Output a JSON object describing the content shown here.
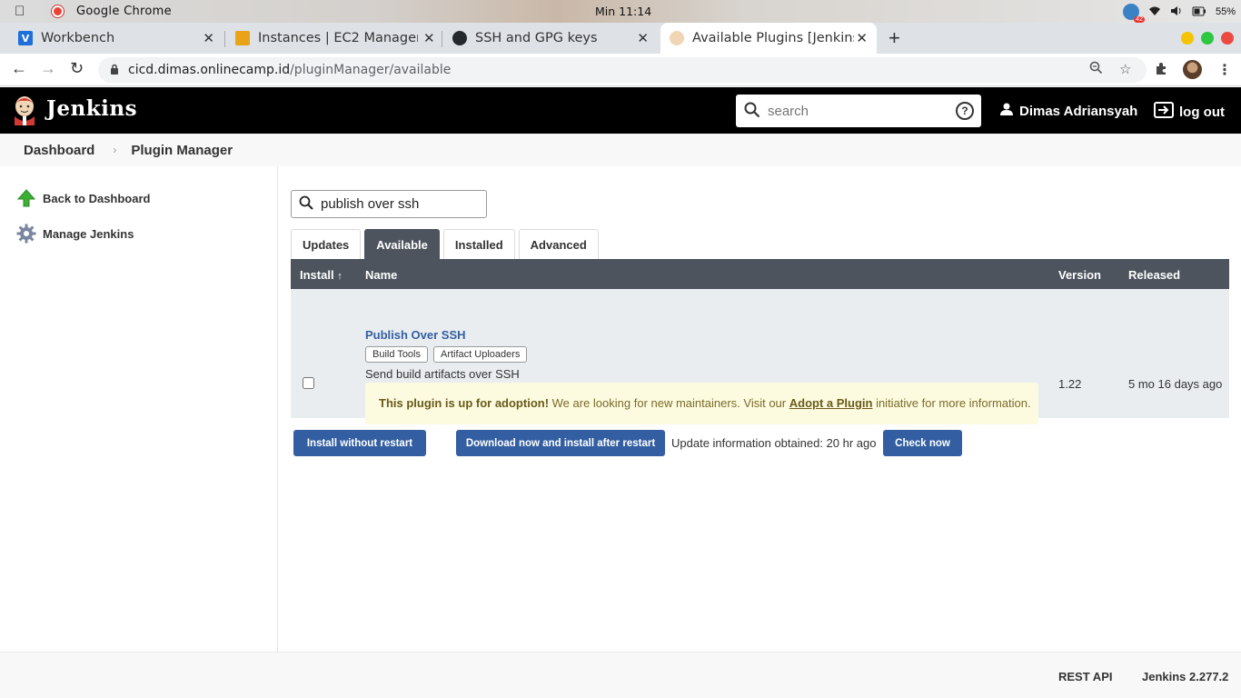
{
  "os": {
    "app_name": "Google Chrome",
    "clock": "Min 11:14",
    "battery": "55%",
    "notif_count": "42"
  },
  "browser": {
    "tabs": [
      {
        "title": "Workbench",
        "fav": "V",
        "fav_color": "#1e6fd9"
      },
      {
        "title": "Instances | EC2 Manageme",
        "fav": "",
        "fav_color": "#e8a317"
      },
      {
        "title": "SSH and GPG keys",
        "fav": "",
        "fav_color": "#24292e"
      },
      {
        "title": "Available Plugins [Jenkins",
        "fav": "",
        "fav_color": "#d33833"
      }
    ],
    "url_host": "cicd.dimas.onlinecamp.id",
    "url_path": "/pluginManager/available"
  },
  "header": {
    "brand": "Jenkins",
    "search_placeholder": "search",
    "help": "?",
    "user": "Dimas Adriansyah",
    "logout": "log out"
  },
  "breadcrumb": {
    "items": [
      "Dashboard",
      "Plugin Manager"
    ]
  },
  "sidebar": {
    "items": [
      {
        "label": "Back to Dashboard",
        "icon": "up-arrow-icon"
      },
      {
        "label": "Manage Jenkins",
        "icon": "gear-icon"
      }
    ]
  },
  "main": {
    "filter_value": "publish over ssh",
    "tabs": [
      "Updates",
      "Available",
      "Installed",
      "Advanced"
    ],
    "active_tab": "Available",
    "columns": {
      "install": "Install",
      "sort_mark": "↑",
      "name": "Name",
      "version": "Version",
      "released": "Released"
    },
    "plugins": [
      {
        "name": "Publish Over SSH",
        "labels": [
          "Build Tools",
          "Artifact Uploaders"
        ],
        "description": "Send build artifacts over SSH",
        "adoption_bold": "This plugin is up for adoption!",
        "adoption_text": " We are looking for new maintainers. Visit our ",
        "adoption_link": "Adopt a Plugin",
        "adoption_tail": " initiative for more information.",
        "version": "1.22",
        "released": "5 mo 16 days ago",
        "checked": false
      }
    ],
    "buttons": {
      "install_without_restart": "Install without restart",
      "download_install_after_restart": "Download now and install after restart",
      "check_now": "Check now"
    },
    "update_info": "Update information obtained: 20 hr ago"
  },
  "footer": {
    "rest_api": "REST API",
    "version": "Jenkins 2.277.2"
  },
  "colors": {
    "header_bg": "#000000",
    "table_header": "#4d545d",
    "button": "#335fa2",
    "link": "#335fa2",
    "adoption_bg": "#fcfbdf"
  }
}
